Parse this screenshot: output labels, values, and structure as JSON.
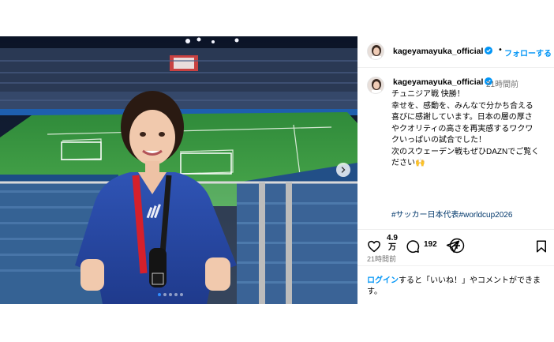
{
  "post": {
    "username": "kageyamayuka_official",
    "dot": "•",
    "follow_label": "フォローする",
    "verified_icon": "verified-badge-icon",
    "caption": {
      "username": "kageyamayuka_official",
      "time": "21時間前",
      "lines": [
        "チュニジア戦 快勝！",
        "幸せを、感動を、みんなで分かち合える",
        "喜びに感謝しています。日本の層の厚さ",
        "やクオリティの高さを再実感するワクワ",
        "クいっぱいの試合でした！",
        "次のスウェーデン戦もぜひDAZNでご覧く",
        "ださい🙌"
      ],
      "hashtags": "#サッカー日本代表#worldcup2026"
    },
    "actions": {
      "likes_line1": "4.9",
      "likes_line2": "万",
      "comments": "192"
    },
    "posted_time": "21時間前",
    "login_prompt": {
      "link": "ログイン",
      "rest": "すると「いいね！」やコメントができます。"
    },
    "carousel": {
      "total": 5,
      "active_index": 0
    },
    "colors": {
      "link_blue": "#0095f6",
      "hashtag_blue": "#00376b",
      "muted": "#737373",
      "verified": "#0095f6"
    }
  }
}
